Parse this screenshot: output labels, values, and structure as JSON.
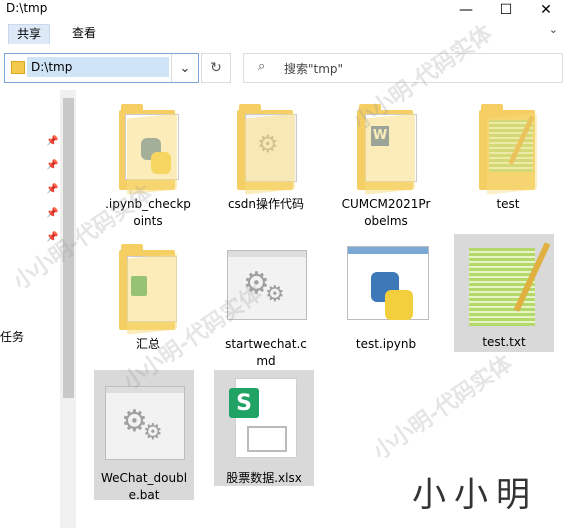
{
  "window": {
    "title": "D:\\tmp",
    "minimize": "—",
    "maximize": "☐",
    "close": "✕"
  },
  "ribbon": {
    "tabs": [
      "共享",
      "查看"
    ],
    "expand": "⌄"
  },
  "address": {
    "path": "D:\\tmp",
    "dropdown": "⌄",
    "refresh": "↻"
  },
  "search": {
    "placeholder": "搜索\"tmp\"",
    "icon": "⌕"
  },
  "nav": {
    "label": "任务",
    "pins": [
      "📌",
      "📌",
      "📌",
      "📌",
      "📌"
    ]
  },
  "items": [
    {
      "label": ".ipynb_checkpoints",
      "type": "folder"
    },
    {
      "label": "csdn操作代码",
      "type": "folder"
    },
    {
      "label": "CUMCM2021Probelms",
      "type": "folder"
    },
    {
      "label": "test",
      "type": "folder"
    },
    {
      "label": "汇总",
      "type": "folder"
    },
    {
      "label": "startwechat.cmd",
      "type": "cmd"
    },
    {
      "label": "test.ipynb",
      "type": "ipynb"
    },
    {
      "label": "test.txt",
      "type": "txt"
    },
    {
      "label": "WeChat_double.bat",
      "type": "bat"
    },
    {
      "label": "股票数据.xlsx",
      "type": "xlsx"
    }
  ],
  "watermark": {
    "text": "小小明-代码实体",
    "signature": "小小明"
  }
}
